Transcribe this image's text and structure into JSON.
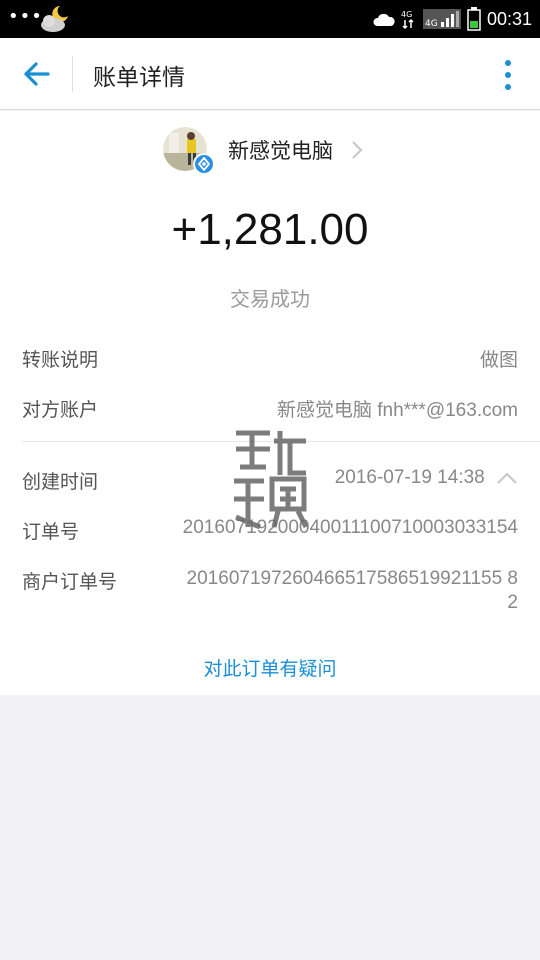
{
  "status_bar": {
    "time": "00:31",
    "network_label": "4G",
    "icons": [
      "more-dots-icon",
      "weather-icon",
      "cloud-upload-icon",
      "signal-4g-icon",
      "signal-bars-icon",
      "battery-icon"
    ]
  },
  "header": {
    "title": "账单详情",
    "back_icon": "arrow-left-icon",
    "more_icon": "more-vertical-icon",
    "accent_color": "#1a8fd6"
  },
  "merchant": {
    "name": "新感觉电脑",
    "verified_icon": "verified-badge-icon"
  },
  "transaction": {
    "amount": "+1,281.00",
    "status": "交易成功"
  },
  "details": [
    {
      "label": "转账说明",
      "value": "做图"
    },
    {
      "label": "对方账户",
      "value": "新感觉电脑 fnh***@163.com"
    },
    {
      "label": "创建时间",
      "value": "2016-07-19 14:38"
    },
    {
      "label": "订单号",
      "value": "20160719200040011100710003033154"
    },
    {
      "label": "商户订单号",
      "value_line1": "201607197260466517586519921155 8",
      "value_line2": "2"
    }
  ],
  "footer": {
    "question_link": "对此订单有疑问"
  }
}
